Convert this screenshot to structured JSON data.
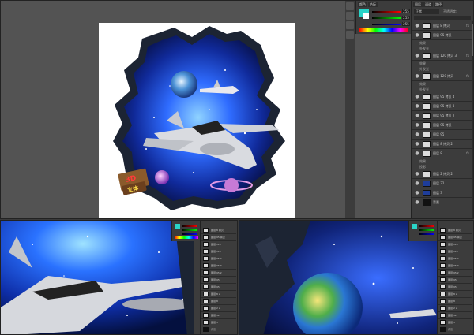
{
  "main": {
    "panel_tabs": [
      "颜色",
      "色板"
    ],
    "rgb": {
      "r": "255",
      "g": "255",
      "b": "255"
    },
    "layers_tabs": [
      "图层",
      "通道",
      "路径"
    ],
    "layer_mode": "正常",
    "opacity": "不透明度:",
    "layers": [
      {
        "name": "图层 8 拷贝",
        "fx": "fx",
        "thumb": "light"
      },
      {
        "name": "图层 95 拷贝",
        "fx": "",
        "thumb": "light"
      },
      {
        "name": "效果",
        "sub": true
      },
      {
        "name": "外发光",
        "sub": true
      },
      {
        "name": "图层 120 拷贝 3",
        "fx": "fx",
        "thumb": "light"
      },
      {
        "name": "效果",
        "sub": true
      },
      {
        "name": "外发光",
        "sub": true
      },
      {
        "name": "图层 120 拷贝",
        "fx": "fx",
        "thumb": "light"
      },
      {
        "name": "效果",
        "sub": true
      },
      {
        "name": "外发光",
        "sub": true
      },
      {
        "name": "图层 95 拷贝 4",
        "fx": "",
        "thumb": "light"
      },
      {
        "name": "图层 95 拷贝 3",
        "fx": "",
        "thumb": "light"
      },
      {
        "name": "图层 95 拷贝 2",
        "fx": "",
        "thumb": "light"
      },
      {
        "name": "图层 95 拷贝",
        "fx": "",
        "thumb": "light"
      },
      {
        "name": "图层 95",
        "fx": "",
        "thumb": "light"
      },
      {
        "name": "图层 8 拷贝 2",
        "fx": "",
        "thumb": "light"
      },
      {
        "name": "图层 8",
        "fx": "fx",
        "thumb": "light"
      },
      {
        "name": "效果",
        "sub": true
      },
      {
        "name": "投影",
        "sub": true
      },
      {
        "name": "图层 2 拷贝 2",
        "fx": "",
        "thumb": "light"
      },
      {
        "name": "图层 32",
        "fx": "",
        "thumb": "blue"
      },
      {
        "name": "图层 3",
        "fx": "",
        "thumb": "blue"
      },
      {
        "name": "背景",
        "fx": "",
        "thumb": "dark"
      }
    ]
  },
  "sub_layers": [
    "图层 8 拷贝",
    "图层 95 拷贝",
    "图层 120",
    "图层 120",
    "图层 95 4",
    "图层 95 3",
    "图层 95 2",
    "图层 95",
    "图层 95",
    "图层 8 2",
    "图层 8",
    "图层 2 2",
    "图层 32",
    "图层 3",
    "背景"
  ],
  "badge": {
    "line1": "3D",
    "line2": "立体"
  },
  "colors": {
    "accent": "#4aa3ff",
    "bg": "#535353",
    "panel": "#3c3c3c"
  }
}
